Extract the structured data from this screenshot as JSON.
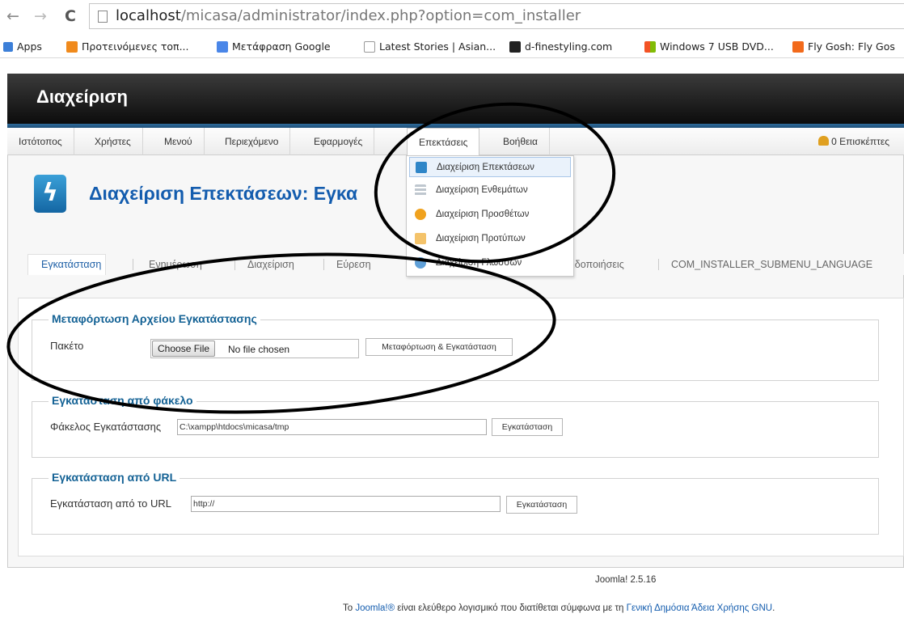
{
  "browser": {
    "back": "←",
    "forward": "→",
    "reload": "C",
    "url_host": "localhost",
    "url_path": "/micasa/administrator/index.php?option=com_installer"
  },
  "bookmarks": [
    {
      "label": "Apps",
      "color": "#3c7fd8"
    },
    {
      "label": "Προτεινόμενες τοπ...",
      "color": "#f08a1c"
    },
    {
      "label": "Μετάφραση Google",
      "color": "#4a86e8"
    },
    {
      "label": "Latest Stories | Asian...",
      "color": "#ffffff"
    },
    {
      "label": "d-finestyling.com",
      "color": "#222222"
    },
    {
      "label": "Windows 7 USB DVD...",
      "color": "#f2a400"
    },
    {
      "label": "Fly Gosh: Fly Gos",
      "color": "#f26a1b"
    }
  ],
  "header": {
    "title": "Διαχείριση"
  },
  "menu": {
    "items": [
      "Ιστότοπος",
      "Χρήστες",
      "Μενού",
      "Περιεχόμενο",
      "Εφαρμογές",
      "Επεκτάσεις",
      "Βοήθεια"
    ],
    "visitors": "0 Επισκέπτες"
  },
  "dropdown": {
    "items": [
      {
        "label": "Διαχείριση Επεκτάσεων",
        "icon": "bolt-icon",
        "color": "#2f86c8"
      },
      {
        "label": "Διαχείριση Ενθεμάτων",
        "icon": "modules-icon",
        "color": "#bfc7cf"
      },
      {
        "label": "Διαχείριση Προσθέτων",
        "icon": "plugin-icon",
        "color": "#f0a21e"
      },
      {
        "label": "Διαχείριση Προτύπων",
        "icon": "template-icon",
        "color": "#f4c36a"
      },
      {
        "label": "Διαχείριση Γλωσσών",
        "icon": "language-icon",
        "color": "#5fa0d8"
      }
    ]
  },
  "page": {
    "title": "Διαχείριση Επεκτάσεων: Εγκα"
  },
  "subtabs": [
    "Εγκατάσταση",
    "Ενημέρωση",
    "Διαχείριση",
    "Εύρεση",
    "ιδοποιήσεις",
    "COM_INSTALLER_SUBMENU_LANGUAGE"
  ],
  "upload": {
    "legend": "Μεταφόρτωση Αρχείου Εγκατάστασης",
    "label": "Πακέτο",
    "choose_btn": "Choose File",
    "no_file": "No file chosen",
    "submit": "Μεταφόρτωση & Εγκατάσταση"
  },
  "folder": {
    "legend": "Εγκατάσταση από φάκελο",
    "label": "Φάκελος Εγκατάστασης",
    "value": "C:\\xampp\\htdocs\\micasa/tmp",
    "submit": "Εγκατάσταση"
  },
  "url": {
    "legend": "Εγκατάσταση από URL",
    "label": "Εγκατάσταση από το URL",
    "value": "http://",
    "submit": "Εγκατάσταση"
  },
  "footer": {
    "version": "Joomla! 2.5.16",
    "text_pre": "Το ",
    "joomla_link": "Joomla!®",
    "text_mid": " είναι ελεύθερο λογισμικό που διατίθεται σύμφωνα με τη ",
    "license_link": "Γενική Δημόσια Άδεια Χρήσης GNU",
    "text_post": "."
  }
}
